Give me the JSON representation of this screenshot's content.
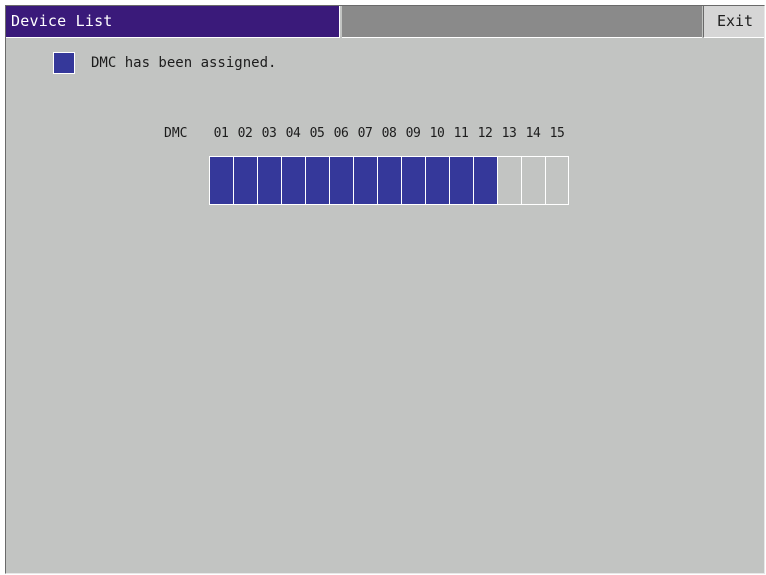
{
  "window": {
    "title": "Device List",
    "exit_label": "Exit"
  },
  "legend": {
    "label": "DMC has been assigned.",
    "assigned_color": "#35389a"
  },
  "dmc_table": {
    "row_label": "DMC",
    "assigned_color": "#35389a",
    "unassigned_color": "#c2c4c2",
    "slots": [
      {
        "number": "01",
        "assigned": true
      },
      {
        "number": "02",
        "assigned": true
      },
      {
        "number": "03",
        "assigned": true
      },
      {
        "number": "04",
        "assigned": true
      },
      {
        "number": "05",
        "assigned": true
      },
      {
        "number": "06",
        "assigned": true
      },
      {
        "number": "07",
        "assigned": true
      },
      {
        "number": "08",
        "assigned": true
      },
      {
        "number": "09",
        "assigned": true
      },
      {
        "number": "10",
        "assigned": true
      },
      {
        "number": "11",
        "assigned": true
      },
      {
        "number": "12",
        "assigned": true
      },
      {
        "number": "13",
        "assigned": false
      },
      {
        "number": "14",
        "assigned": false
      },
      {
        "number": "15",
        "assigned": false
      }
    ]
  }
}
